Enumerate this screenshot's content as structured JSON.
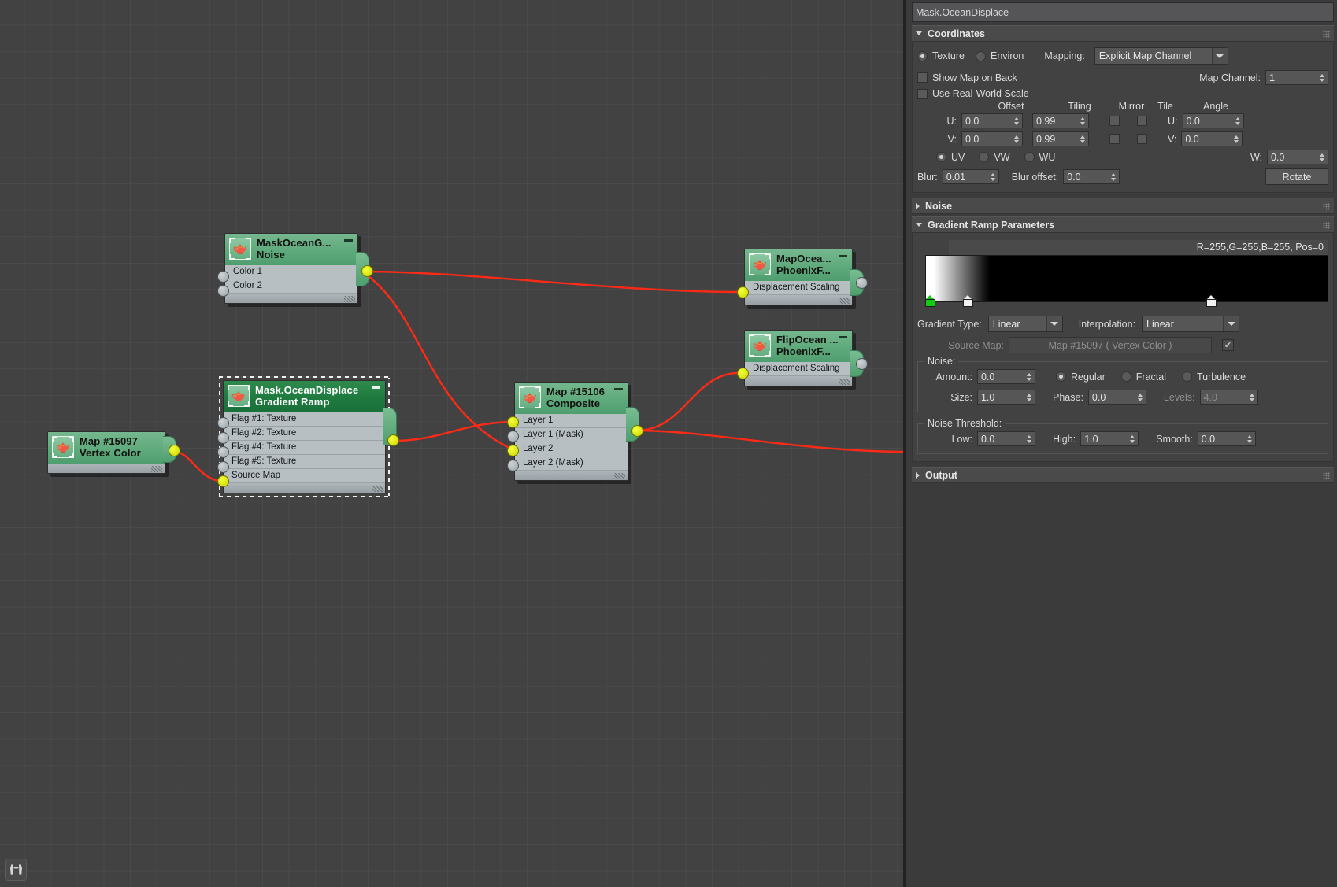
{
  "window": {
    "title": "Mask.OceanDisplace"
  },
  "graph": {
    "nodes": [
      {
        "id": "vertex-color",
        "title": "Map #15097",
        "subtitle": "Vertex Color",
        "rows": [],
        "icon": "teapot-icon"
      },
      {
        "id": "noise",
        "title": "MaskOceanG...",
        "subtitle": "Noise",
        "rows": [
          "Color 1",
          "Color 2"
        ],
        "icon": "teapot-icon"
      },
      {
        "id": "gradient-ramp",
        "title": "Mask.OceanDisplace",
        "subtitle": "Gradient Ramp",
        "rows": [
          "Flag #1: Texture",
          "Flag #2: Texture",
          "Flag #4: Texture",
          "Flag #5: Texture",
          "Source Map"
        ],
        "icon": "teapot-icon",
        "selected": true
      },
      {
        "id": "composite",
        "title": "Map #15106",
        "subtitle": "Composite",
        "rows": [
          "Layer 1",
          "Layer 1 (Mask)",
          "Layer 2",
          "Layer 2 (Mask)"
        ],
        "icon": "teapot-icon"
      },
      {
        "id": "map-ocean",
        "title": "MapOcea...",
        "subtitle": "PhoenixF...",
        "rows": [
          "Displacement Scaling"
        ],
        "icon": "teapot-icon"
      },
      {
        "id": "flip-ocean",
        "title": "FlipOcean ...",
        "subtitle": "PhoenixF...",
        "rows": [
          "Displacement Scaling"
        ],
        "icon": "teapot-icon"
      }
    ],
    "toolbar": {
      "zoom_extents_icon": "binoculars-icon"
    }
  },
  "panel": {
    "coordinates": {
      "header": "Coordinates",
      "texture_label": "Texture",
      "environ_label": "Environ",
      "mapping_label": "Mapping:",
      "mapping_value": "Explicit Map Channel",
      "show_map_on_back": "Show Map on Back",
      "map_channel_label": "Map Channel:",
      "map_channel_value": "1",
      "use_real_world_scale": "Use Real-World Scale",
      "col_offset": "Offset",
      "col_tiling": "Tiling",
      "col_mirror": "Mirror",
      "col_tile": "Tile",
      "col_angle": "Angle",
      "u_label": "U:",
      "v_label": "V:",
      "w_label": "W:",
      "offset_u": "0.0",
      "offset_v": "0.0",
      "tiling_u": "0.99",
      "tiling_v": "0.99",
      "angle_u": "0.0",
      "angle_v": "0.0",
      "angle_w": "0.0",
      "uv_label": "UV",
      "vw_label": "VW",
      "wu_label": "WU",
      "blur_label": "Blur:",
      "blur_value": "0.01",
      "blur_offset_label": "Blur offset:",
      "blur_offset_value": "0.0",
      "rotate_label": "Rotate"
    },
    "noise_rollout": {
      "header": "Noise"
    },
    "gradient": {
      "header": "Gradient Ramp Parameters",
      "flag_info": "R=255,G=255,B=255, Pos=0",
      "gradient_type_label": "Gradient Type:",
      "gradient_type_value": "Linear",
      "interpolation_label": "Interpolation:",
      "interpolation_value": "Linear",
      "source_map_label": "Source Map:",
      "source_map_value": "Map #15097  ( Vertex Color )",
      "source_map_checked": "✔",
      "noise_legend": "Noise:",
      "amount_label": "Amount:",
      "amount_value": "0.0",
      "regular_label": "Regular",
      "fractal_label": "Fractal",
      "turbulence_label": "Turbulence",
      "size_label": "Size:",
      "size_value": "1.0",
      "phase_label": "Phase:",
      "phase_value": "0.0",
      "levels_label": "Levels:",
      "levels_value": "4.0",
      "threshold_legend": "Noise Threshold:",
      "low_label": "Low:",
      "low_value": "0.0",
      "high_label": "High:",
      "high_value": "1.0",
      "smooth_label": "Smooth:",
      "smooth_value": "0.0"
    },
    "output_rollout": {
      "header": "Output"
    }
  },
  "colors": {
    "wire": "#ff2a16",
    "node_header": "#5faa7c",
    "node_header_selected": "#1f7a3f",
    "socket_connected": "#e4f000",
    "flag_selected": "#12cc12"
  }
}
